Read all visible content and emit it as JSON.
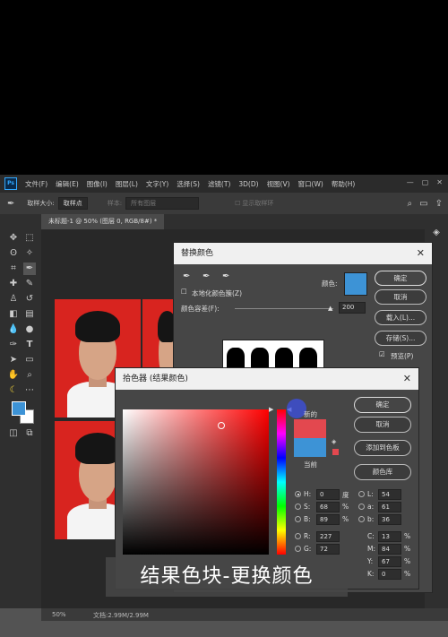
{
  "app": {
    "logo": "Ps",
    "menus": [
      "文件(F)",
      "编辑(E)",
      "图像(I)",
      "图层(L)",
      "文字(Y)",
      "选择(S)",
      "滤镜(T)",
      "3D(D)",
      "视图(V)",
      "窗口(W)",
      "帮助(H)"
    ]
  },
  "options_bar": {
    "sample_size_label": "取样大小:",
    "sample_size_value": "取样点",
    "sample_label": "样本:",
    "sample_value": "所有图层",
    "show_ring": "显示取样环"
  },
  "document_tab": {
    "title": "未标题-1 @ 50% (图层 0, RGB/8#) *"
  },
  "status_bar": {
    "zoom": "50%",
    "doc_info": "文档:2.99M/2.99M"
  },
  "replace_color_dialog": {
    "title": "替换颜色",
    "localized_label": "本地化颜色簇(Z)",
    "color_label": "颜色:",
    "tolerance_label": "颜色容差(F):",
    "tolerance_value": "200",
    "swatch_color": "#3d93d6",
    "buttons": {
      "ok": "确定",
      "cancel": "取消",
      "load": "载入(L)...",
      "save": "存储(S)...",
      "preview": "预览(P)"
    }
  },
  "color_picker_dialog": {
    "title": "拾色器 (结果颜色)",
    "new_label": "新的",
    "current_label": "当前",
    "new_color": "#e3484f",
    "current_color": "#3d93d6",
    "buttons": {
      "ok": "确定",
      "cancel": "取消",
      "add_swatch": "添加到色板",
      "library": "颜色库"
    },
    "hsb": {
      "h": "0",
      "s": "68",
      "b": "89",
      "h_unit": "度",
      "s_unit": "%",
      "b_unit": "%"
    },
    "lab": {
      "l": "54",
      "a": "61",
      "b": "36"
    },
    "rgb": {
      "r": "227",
      "g": "72"
    },
    "cmyk": {
      "c": "13",
      "m": "84",
      "y": "67",
      "k": "0",
      "unit": "%"
    },
    "labels": {
      "h": "H:",
      "s": "S:",
      "b": "B:",
      "r": "R:",
      "g": "G:",
      "l": "L:",
      "a": "a:",
      "lab_b": "b:",
      "c": "C:",
      "m": "M:",
      "y": "Y:",
      "k": "K:"
    }
  },
  "caption": "结果色块-更换颜色",
  "colors": {
    "foreground": "#3d93d6",
    "background": "#ffffff",
    "hue": "#ff0000"
  }
}
